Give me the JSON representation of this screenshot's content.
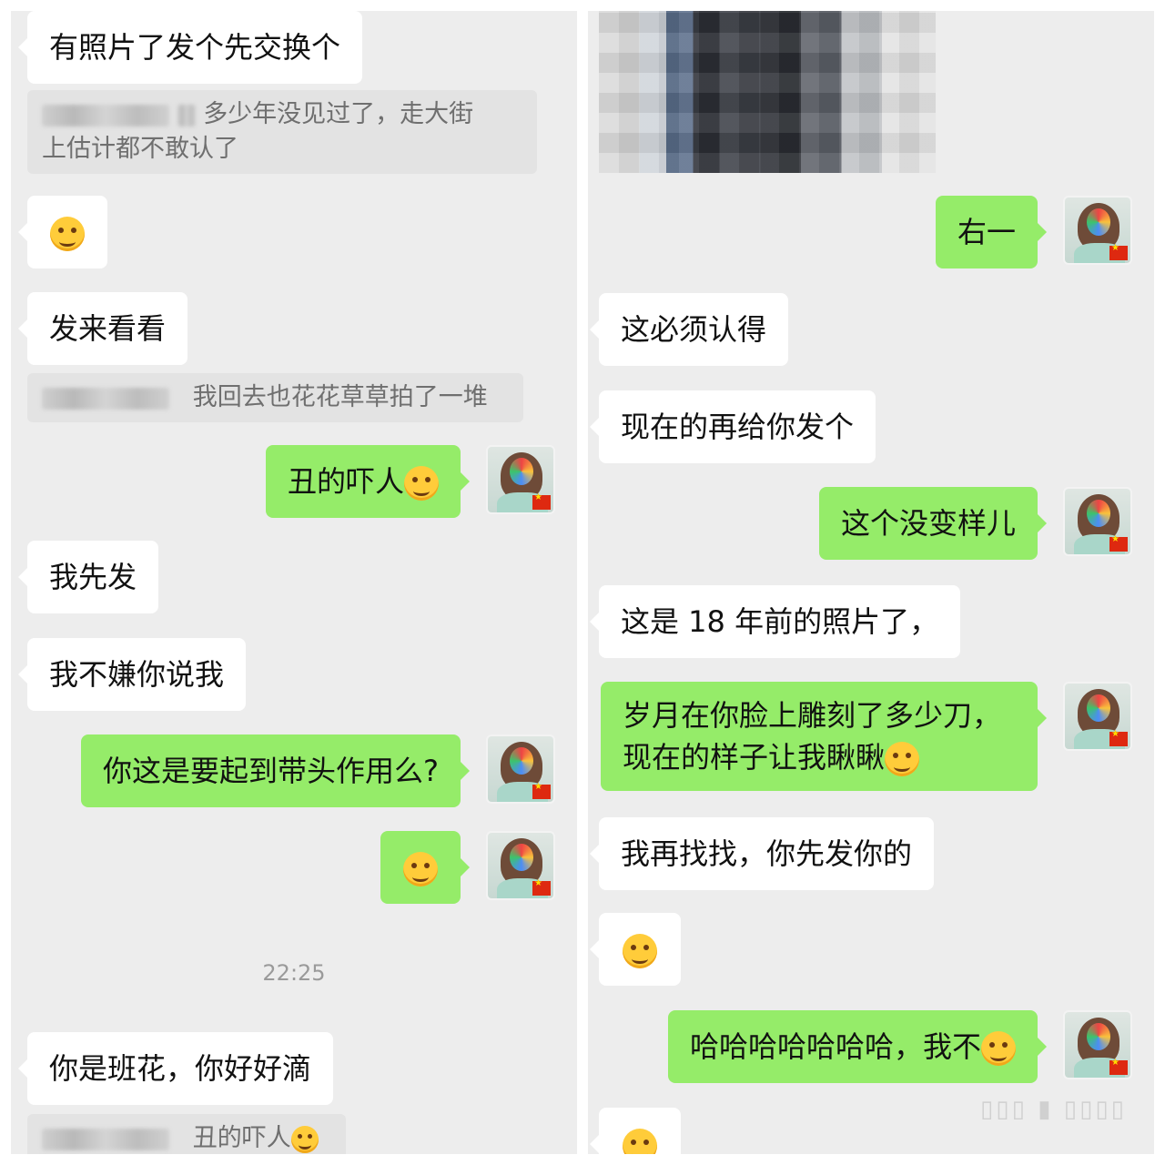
{
  "left": {
    "messages": [
      {
        "text": "有照片了发个先交换个"
      },
      {
        "quote": "多少年没见过了，走大街",
        "quote2": "上估计都不敢认了"
      },
      {
        "emoji": "thinking-face-emoji"
      },
      {
        "text": "发来看看"
      },
      {
        "quote": "我回去也花花草草拍了一堆"
      },
      {
        "text": "丑的吓人"
      },
      {
        "text": "我先发"
      },
      {
        "text": "我不嫌你说我"
      },
      {
        "text": "你这是要起到带头作用么?"
      },
      {
        "emoji": "tears-of-joy-emoji"
      },
      {
        "time": "22:25"
      },
      {
        "text": "你是班花，你好好滴"
      },
      {
        "quote": "丑的吓人"
      }
    ]
  },
  "right": {
    "messages": [
      {
        "text": "右一"
      },
      {
        "text": "这必须认得"
      },
      {
        "text": "现在的再给你发个"
      },
      {
        "text": "这个没变样儿"
      },
      {
        "text": "这是 18 年前的照片了，"
      },
      {
        "line1": "岁月在你脸上雕刻了多少刀，",
        "line2": "现在的样子让我瞅瞅"
      },
      {
        "text": "我再找找，你先发你的"
      },
      {
        "emoji": "smile-emoji"
      },
      {
        "text": "哈哈哈哈哈哈哈，我不"
      },
      {
        "emoji": "flushed-emoji"
      }
    ]
  },
  "colors": {
    "sent": "#95ec69",
    "received": "#ffffff",
    "background": "#ededed"
  }
}
